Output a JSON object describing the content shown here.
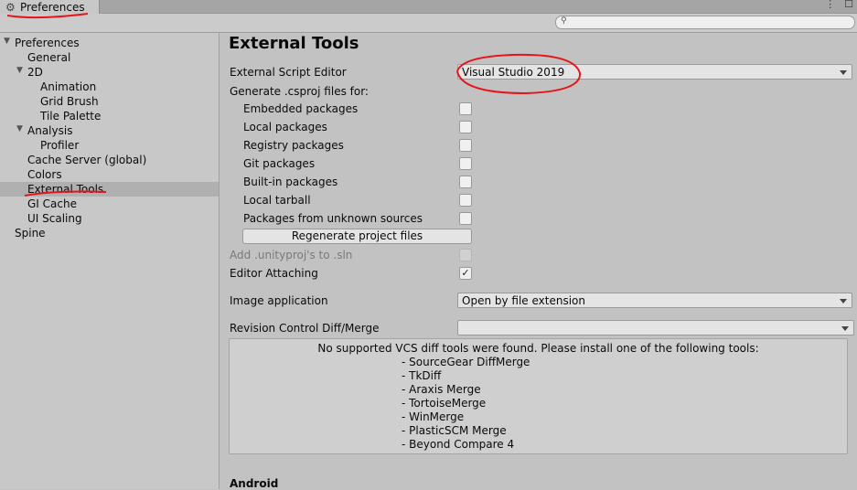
{
  "window": {
    "tab_title": "Preferences",
    "tab_icon": "gear-icon",
    "controls": [
      "⋮",
      "☐"
    ]
  },
  "search": {
    "placeholder": ""
  },
  "sidebar": {
    "items": [
      {
        "label": "Preferences"
      },
      {
        "label": "General"
      },
      {
        "label": "2D"
      },
      {
        "label": "Animation"
      },
      {
        "label": "Grid Brush"
      },
      {
        "label": "Tile Palette"
      },
      {
        "label": "Analysis"
      },
      {
        "label": "Profiler"
      },
      {
        "label": "Cache Server (global)"
      },
      {
        "label": "Colors"
      },
      {
        "label": "External Tools",
        "selected": true
      },
      {
        "label": "GI Cache"
      },
      {
        "label": "UI Scaling"
      },
      {
        "label": "Spine"
      }
    ]
  },
  "main": {
    "title": "External Tools",
    "script_editor_label": "External Script Editor",
    "script_editor_value": "Visual Studio 2019",
    "csproj_label": "Generate .csproj files for:",
    "csproj_options": [
      {
        "label": "Embedded packages",
        "checked": false
      },
      {
        "label": "Local packages",
        "checked": false
      },
      {
        "label": "Registry packages",
        "checked": false
      },
      {
        "label": "Git packages",
        "checked": false
      },
      {
        "label": "Built-in packages",
        "checked": false
      },
      {
        "label": "Local tarball",
        "checked": false
      },
      {
        "label": "Packages from unknown sources",
        "checked": false
      }
    ],
    "regenerate_button": "Regenerate project files",
    "add_unityproj_label": "Add .unityproj's to .sln",
    "editor_attaching_label": "Editor Attaching",
    "editor_attaching_checked": "✓",
    "image_app_label": "Image application",
    "image_app_value": "Open by file extension",
    "revision_label": "Revision Control Diff/Merge",
    "revision_value": "",
    "vcs_message": "No supported VCS diff tools were found. Please install one of the following tools:",
    "vcs_tools": [
      "- SourceGear DiffMerge",
      "- TkDiff",
      "- Araxis Merge",
      "- TortoiseMerge",
      "- WinMerge",
      "- PlasticSCM Merge",
      "- Beyond Compare 4"
    ],
    "android_heading": "Android"
  },
  "colors": {
    "annotation": "#e8141b"
  }
}
